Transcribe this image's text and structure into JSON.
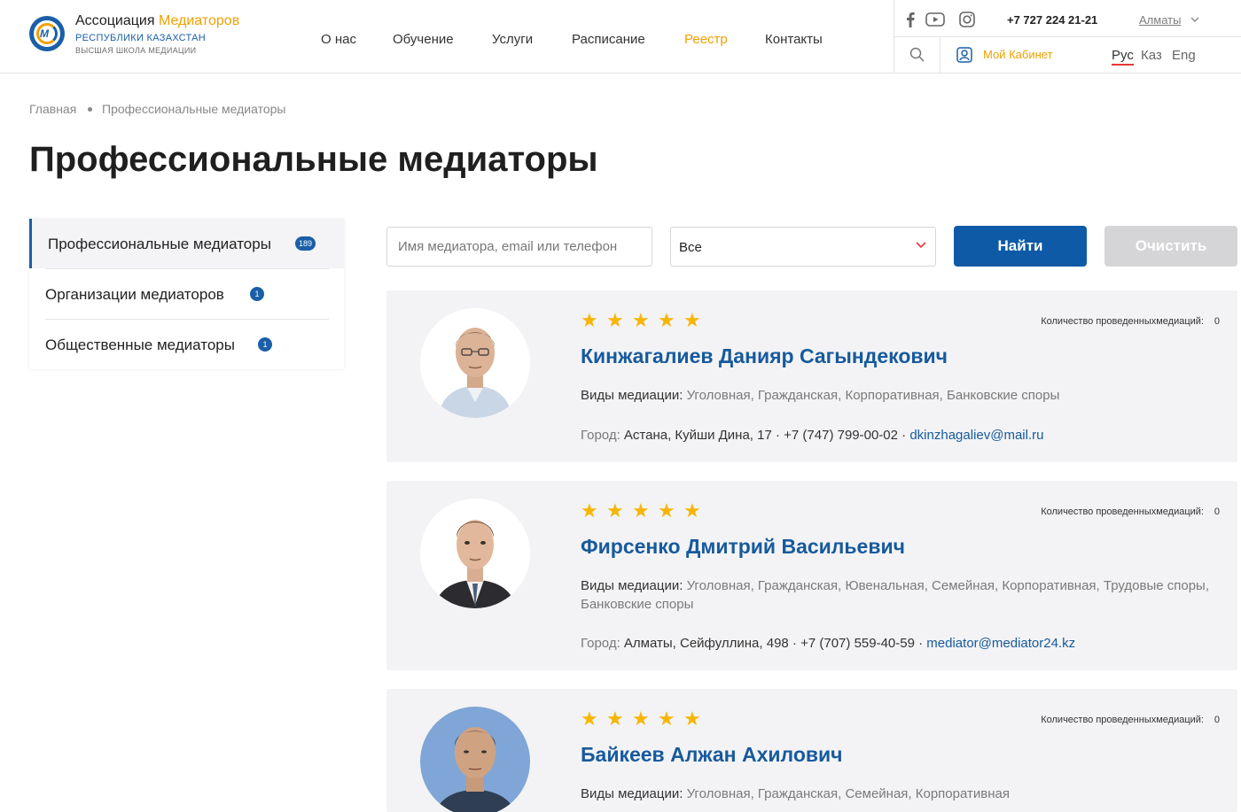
{
  "header": {
    "brand_name_1": "Ассоциация ",
    "brand_name_2": "Медиаторов",
    "brand_sub_1": "РЕСПУБЛИКИ КАЗАХСТАН",
    "brand_sub_2": "ВЫСШАЯ ШКОЛА МЕДИАЦИИ",
    "nav": [
      "О нас",
      "Обучение",
      "Услуги",
      "Расписание",
      "Реестр",
      "Контакты"
    ],
    "nav_active": "Реестр",
    "phone": "+7 727 224 21-21",
    "city": "Алматы",
    "cabinet": "Мой Кабинет",
    "languages": [
      "Рус",
      "Каз",
      "Eng"
    ],
    "language_active": "Рус"
  },
  "breadcrumb": {
    "home": "Главная",
    "current": "Профессиональные медиаторы"
  },
  "page_title": "Профессиональные медиаторы",
  "sidebar": {
    "items": [
      {
        "label": "Профессиональные медиаторы",
        "count": "189",
        "active": true
      },
      {
        "label": "Организации медиаторов",
        "count": "1",
        "active": false
      },
      {
        "label": "Общественные медиаторы",
        "count": "1",
        "active": false
      }
    ]
  },
  "search": {
    "placeholder": "Имя медиатора, email или телефон",
    "value": "",
    "filter_selected": "Все",
    "find_label": "Найти",
    "clear_label": "Очистить"
  },
  "mediators": [
    {
      "rating": 5,
      "count_label": "Количество проведенныхмедиаций:",
      "count": "0",
      "name": "Кинжагалиев Данияр Сагындекович",
      "types_label": "Виды медиации:",
      "types": "Уголовная, Гражданская, Корпоративная, Банковские споры",
      "city_label": "Город:",
      "address": "Астана, Куйши Дина, 17",
      "phone": "+7 (747) 799-00-02",
      "email": "dkinzhagaliev@mail.ru"
    },
    {
      "rating": 5,
      "count_label": "Количество проведенныхмедиаций:",
      "count": "0",
      "name": "Фирсенко Дмитрий Васильевич",
      "types_label": "Виды медиации:",
      "types": "Уголовная, Гражданская, Ювенальная, Семейная, Корпоративная, Трудовые споры, Банковские споры",
      "city_label": "Город:",
      "address": "Алматы, Сейфуллина, 498",
      "phone": "+7 (707) 559-40-59",
      "email": "mediator@mediator24.kz"
    },
    {
      "rating": 5,
      "count_label": "Количество проведенныхмедиаций:",
      "count": "0",
      "name": "Байкеев Алжан Ахилович",
      "types_label": "Виды медиации:",
      "types": "Уголовная, Гражданская, Семейная, Корпоративная"
    }
  ],
  "colors": {
    "accent_blue": "#0e5aa7",
    "accent_orange": "#f0a000",
    "star": "#f7b500",
    "card_bg": "#f3f3f5"
  },
  "icons": [
    "facebook-icon",
    "youtube-icon",
    "instagram-icon",
    "chevron-down-icon",
    "search-icon",
    "user-icon",
    "star-icon"
  ]
}
